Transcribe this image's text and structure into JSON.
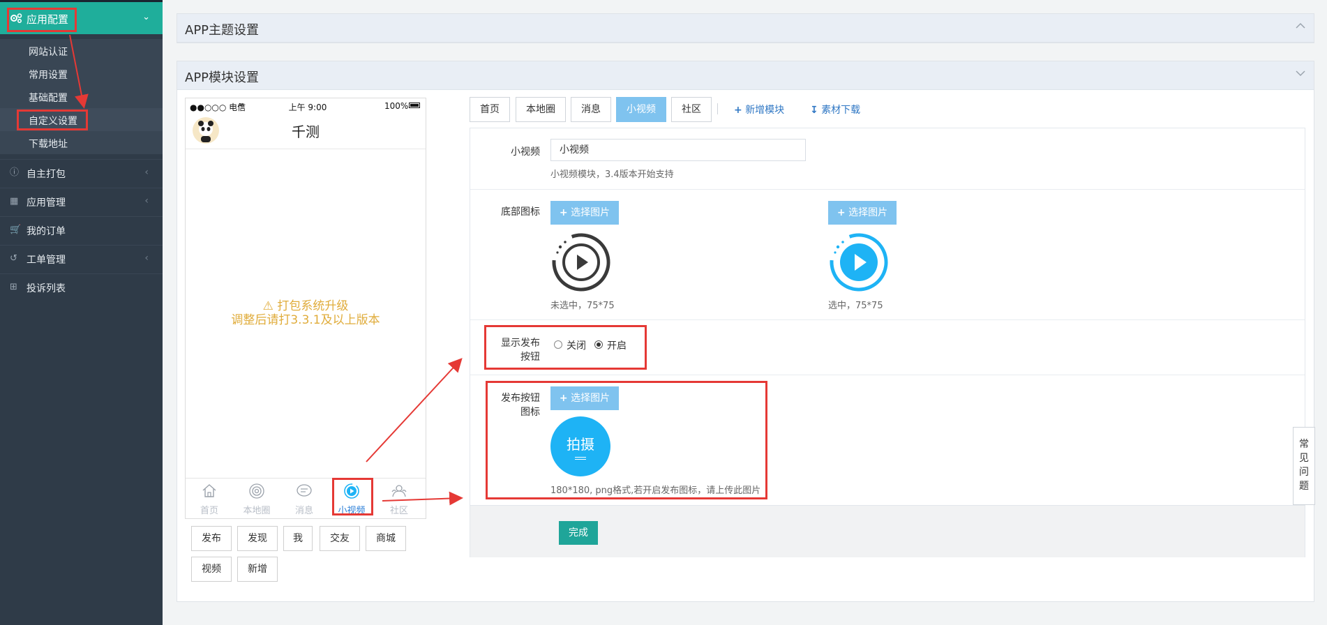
{
  "sidebar": {
    "header": {
      "label": "应用配置",
      "icon": "gears-icon"
    },
    "sub_items": [
      "网站认证",
      "常用设置",
      "基础配置",
      "自定义设置",
      "下载地址"
    ],
    "groups": [
      {
        "label": "自主打包",
        "icon": "info-icon",
        "has_arrow": true
      },
      {
        "label": "应用管理",
        "icon": "grid-icon",
        "has_arrow": true
      },
      {
        "label": "我的订单",
        "icon": "cart-icon",
        "has_arrow": false
      },
      {
        "label": "工单管理",
        "icon": "history-icon",
        "has_arrow": true
      },
      {
        "label": "投诉列表",
        "icon": "plus-square-icon",
        "has_arrow": false
      }
    ]
  },
  "panels": {
    "theme_title": "APP主题设置",
    "module_title": "APP模块设置"
  },
  "phone": {
    "status_left": "●●○○○ 电信",
    "status_time": "上午 9:00",
    "status_battery": "100%",
    "app_title": "千测",
    "notice_line1": "⚠ 打包系统升级",
    "notice_line2": "调整后请打3.3.1及以上版本",
    "tabs": [
      {
        "label": "首页",
        "icon": "home-icon"
      },
      {
        "label": "本地圈",
        "icon": "radar-icon"
      },
      {
        "label": "消息",
        "icon": "chat-icon"
      },
      {
        "label": "小视频",
        "icon": "play-circle-icon"
      },
      {
        "label": "社区",
        "icon": "community-icon"
      }
    ]
  },
  "module_buttons": [
    "发布",
    "发现",
    "我",
    "交友",
    "商城",
    "视频",
    "新增"
  ],
  "editor_tabs": [
    "首页",
    "本地圈",
    "消息",
    "小视频",
    "社区"
  ],
  "editor_links": {
    "add_module": "新增模块",
    "download_assets": "素材下载"
  },
  "form": {
    "name_label": "小视频",
    "name_value": "小视频",
    "name_help": "小视频模块，3.4版本开始支持",
    "bottom_icon_label": "底部图标",
    "pick_image": "选择图片",
    "unselected_caption": "未选中，75*75",
    "selected_caption": "选中，75*75",
    "show_publish_label_1": "显示发布",
    "show_publish_label_2": "按钮",
    "radio_off": "关闭",
    "radio_on": "开启",
    "radio_selected": "开启",
    "publish_icon_label_1": "发布按钮",
    "publish_icon_label_2": "图标",
    "publish_icon_text": "拍摄",
    "publish_help": "180*180, png格式,若开启发布图标，请上传此图片",
    "done": "完成"
  },
  "faq": "常见问题",
  "colors": {
    "sidebar_bg": "#2f3b48",
    "accent_teal": "#1fae9b",
    "tab_active": "#7fc3ef",
    "play_blue": "#1eb3f5",
    "annotation_red": "#e53935",
    "notice_gold": "#e0ac3b"
  }
}
